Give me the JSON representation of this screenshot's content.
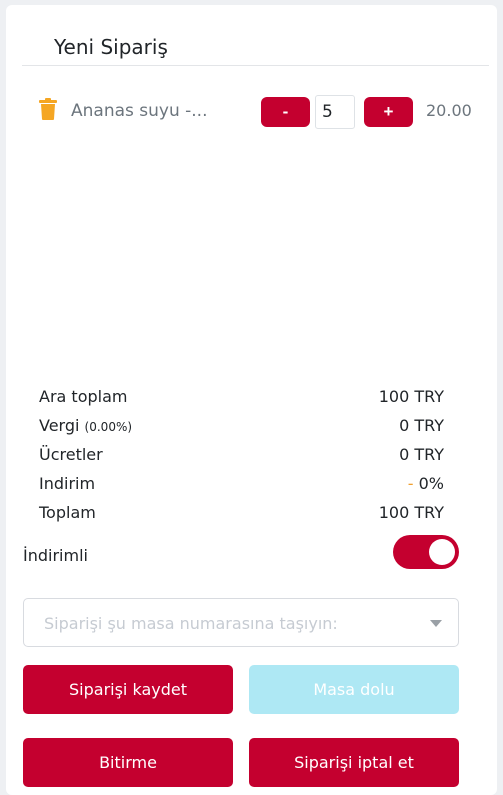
{
  "header": {
    "title": "Yeni Sipariş"
  },
  "item": {
    "name": "Ananas suyu -...",
    "quantity": "5",
    "price": "20.00",
    "minus_label": "-",
    "plus_label": "+"
  },
  "totals": [
    {
      "label": "Ara toplam",
      "value": "100 TRY"
    },
    {
      "label": "Vergi",
      "note": "(0.00%)",
      "value": "0 TRY"
    },
    {
      "label": "Ücretler",
      "value": "0 TRY"
    },
    {
      "label": "Indirim",
      "value_prefix": "-",
      "value": "0%"
    },
    {
      "label": "Toplam",
      "value": "100 TRY"
    }
  ],
  "discount_toggle": {
    "label": "İndirimli",
    "on": true
  },
  "table_select": {
    "placeholder": "Siparişi şu masa numarasına taşıyın:"
  },
  "buttons": {
    "save": "Siparişi kaydet",
    "table_full": "Masa dolu",
    "finish": "Bitirme",
    "cancel": "Siparişi iptal et"
  },
  "colors": {
    "primary": "#c4002f",
    "disabled": "#aee8f4",
    "trash": "#f5a623"
  },
  "icons": {
    "delete": "trash-icon",
    "dropdown": "caret-down-icon"
  }
}
